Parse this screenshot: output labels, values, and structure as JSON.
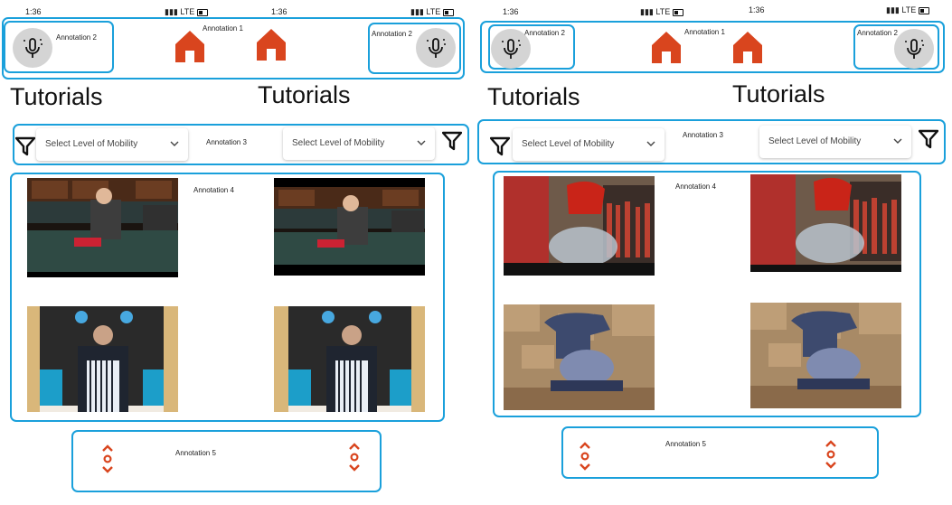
{
  "status_bar": {
    "times": [
      "1:36",
      "1:36",
      "1:36",
      "1:36"
    ],
    "signal": [
      "LTE",
      "LTE",
      "LTE",
      "LTE"
    ]
  },
  "annotations": {
    "a1": "Annotation 1",
    "a2": "Annotation 2",
    "a3": "Annotation 3",
    "a4": "Annotation 4",
    "a5": "Annotation 5"
  },
  "page": {
    "title": "Tutorials"
  },
  "filter": {
    "placeholder": "Select Level of Mobility"
  },
  "icons": {
    "mic": "voice-search-mic-icon",
    "home": "home-icon",
    "filter": "filter-funnel-icon",
    "scroll": "scroll-up-down-icon",
    "chevron": "chevron-down-icon"
  },
  "colors": {
    "accent": "#d9451e",
    "annotation_box": "#1aa0db",
    "mic_bg": "#d4d4d4"
  },
  "videos": {
    "left": [
      "Woman cooking in kitchen",
      "Man in striped apron at table"
    ],
    "right": [
      "Hands using red stand mixer",
      "Blue stand mixer on counter"
    ]
  }
}
